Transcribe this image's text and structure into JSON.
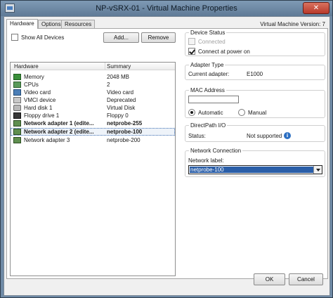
{
  "window": {
    "title": "NP-vSRX-01 - Virtual Machine Properties",
    "close_glyph": "✕"
  },
  "tabs": [
    {
      "label": "Hardware"
    },
    {
      "label": "Options"
    },
    {
      "label": "Resources"
    }
  ],
  "vm_version": "Virtual Machine Version: 7",
  "hardware": {
    "show_all_devices_label": "Show All Devices",
    "add_button": "Add...",
    "remove_button": "Remove",
    "columns": {
      "hardware": "Hardware",
      "summary": "Summary"
    },
    "rows": [
      {
        "name": "Memory",
        "summary": "2048 MB",
        "icon": "memory-icon"
      },
      {
        "name": "CPUs",
        "summary": "2",
        "icon": "cpu-icon"
      },
      {
        "name": "Video card",
        "summary": "Video card",
        "icon": "video-card-icon"
      },
      {
        "name": "VMCI device",
        "summary": "Deprecated",
        "icon": "vmci-device-icon"
      },
      {
        "name": "Hard disk 1",
        "summary": "Virtual Disk",
        "icon": "hard-disk-icon"
      },
      {
        "name": "Floppy drive 1",
        "summary": "Floppy 0",
        "icon": "floppy-drive-icon"
      },
      {
        "name": "Network adapter 1 (edite...",
        "summary": "netprobe-255",
        "icon": "network-adapter-icon"
      },
      {
        "name": "Network adapter 2 (edite...",
        "summary": "netprobe-100",
        "icon": "network-adapter-icon"
      },
      {
        "name": "Network adapter 3",
        "summary": "netprobe-200",
        "icon": "network-adapter-icon"
      }
    ]
  },
  "device_status": {
    "title": "Device Status",
    "connected_label": "Connected",
    "connect_at_power_on_label": "Connect at power on"
  },
  "adapter_type": {
    "title": "Adapter Type",
    "current_adapter_label": "Current adapter:",
    "current_adapter_value": "E1000"
  },
  "mac_address": {
    "title": "MAC Address",
    "value": "",
    "automatic_label": "Automatic",
    "manual_label": "Manual"
  },
  "directpath": {
    "title": "DirectPath I/O",
    "status_label": "Status:",
    "status_value": "Not supported",
    "info_glyph": "i"
  },
  "network_connection": {
    "title": "Network Connection",
    "network_label": "Network label:",
    "selected_value": "netprobe-100"
  },
  "footer": {
    "ok_button": "OK",
    "cancel_button": "Cancel"
  }
}
